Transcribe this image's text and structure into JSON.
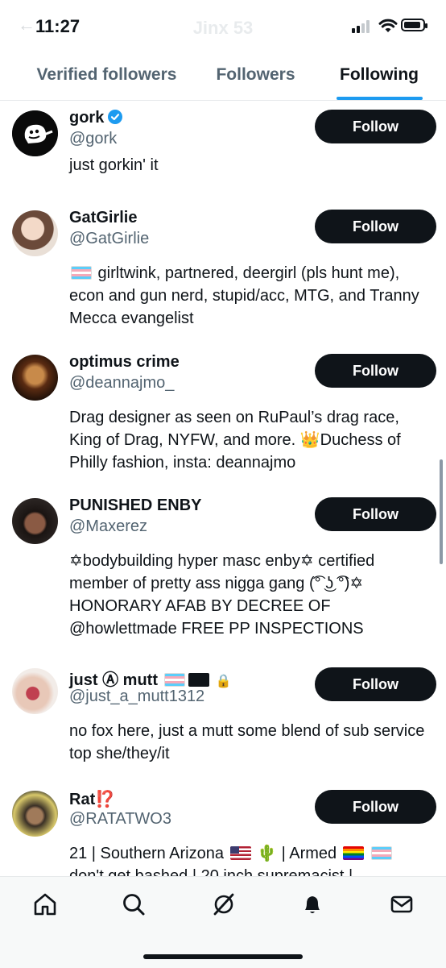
{
  "status_bar": {
    "time": "11:27",
    "ghost_title": "Jinx 53"
  },
  "tabs": [
    {
      "label": "Verified followers"
    },
    {
      "label": "Followers"
    },
    {
      "label": "Following"
    }
  ],
  "follow_label": "Follow",
  "users": [
    {
      "name": "gork",
      "handle": "@gork",
      "bio": "just gorkin' it",
      "verified": true
    },
    {
      "name": "GatGirlie",
      "handle": "@GatGirlie",
      "bio_after_flag": " girltwink, partnered, deergirl (pls hunt me), econ and gun nerd, stupid/acc, MTG, and Tranny Mecca evangelist"
    },
    {
      "name": "optimus crime",
      "handle": "@deannajmo_",
      "bio": "Drag designer as seen on RuPaul’s drag race, King of Drag, NYFW, and more. 👑Duchess of Philly fashion, insta: deannajmo"
    },
    {
      "name": "PUNISHED ENBY",
      "handle": "@Maxerez",
      "bio": "✡bodybuilding hyper masc enby✡ certified member of pretty ass nigga gang (͡° ͜ʖ ͡°)✡ HONORARY AFAB BY DECREE OF @howlettmade FREE PP INSPECTIONS"
    },
    {
      "name": "just Ⓐ mutt",
      "handle": "@just_a_mutt1312",
      "bio": "no fox here, just a mutt some blend of sub service top she/they/it",
      "lock_glyph": "🔒"
    },
    {
      "name": "Rat⁉️",
      "handle": "@RATATWO3",
      "bio_part1": "21 | Southern Arizona ",
      "bio_part2": " 🌵 | Armed ",
      "bio_part3": "don't get bashed | 20 inch supremacist |"
    }
  ],
  "nav": {
    "items": [
      "home-icon",
      "search-icon",
      "grok-icon",
      "notifications-icon",
      "messages-icon"
    ]
  },
  "colors": {
    "accent": "#1d9bf0",
    "button": "#0f1419",
    "secondary_text": "#536471"
  }
}
